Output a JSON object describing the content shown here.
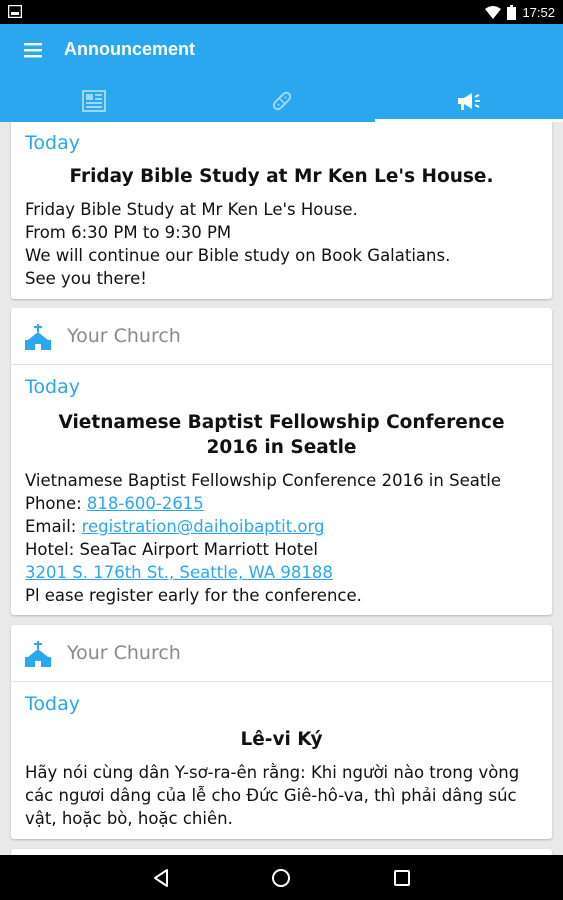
{
  "status_bar": {
    "time": "17:52"
  },
  "app_bar": {
    "title": "Announcement",
    "tabs": [
      {
        "name": "news-icon",
        "active": false
      },
      {
        "name": "bandage-icon",
        "active": false
      },
      {
        "name": "megaphone-icon",
        "active": true
      }
    ]
  },
  "colors": {
    "accent": "#2aa7ef",
    "header_text": "#8a8a8a"
  },
  "posts": [
    {
      "church": "",
      "date": "Today",
      "title": "Friday Bible Study at Mr Ken Le's House.",
      "lines": [
        "Friday Bible Study at Mr Ken Le's House.",
        "From 6:30 PM to 9:30 PM",
        "We will continue our Bible study on Book Galatians.",
        "See you there!"
      ]
    },
    {
      "church": "Your Church",
      "date": "Today",
      "title": "Vietnamese Baptist Fellowship Conference 2016 in Seatle",
      "line1": "Vietnamese Baptist Fellowship Conference 2016 in Seatle",
      "phone_label": "Phone: ",
      "phone": "818-600-2615",
      "email_label": "Email: ",
      "email": "registration@daihoibaptit.org",
      "hotel": "Hotel: SeaTac Airport Marriott Hotel",
      "address": "3201 S. 176th St., Seattle, WA 98188",
      "closing": "Pl ease register early for the conference."
    },
    {
      "church": "Your Church",
      "date": "Today",
      "title": "Lê-vi Ký",
      "lines": [
        "Hãy nói cùng dân Y-sơ-ra-ên rằng: Khi người nào trong vòng",
        "các ngươi dâng của lễ cho Đức Giê-hô-va, thì phải dâng súc",
        "vật, hoặc bò, hoặc chiên."
      ]
    }
  ]
}
